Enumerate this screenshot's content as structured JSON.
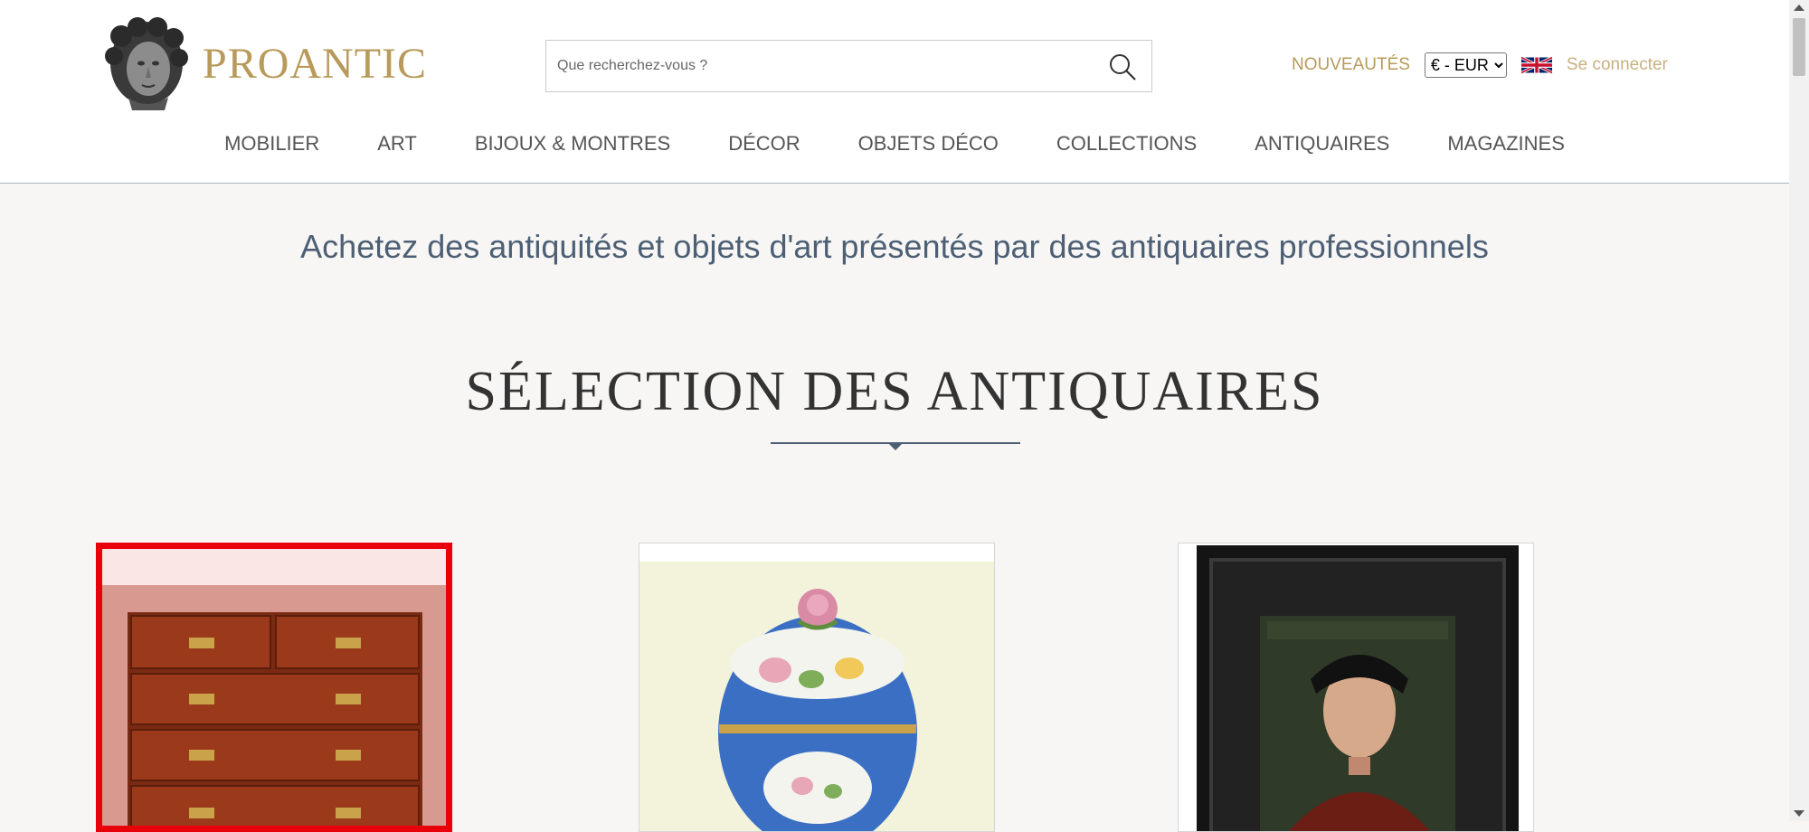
{
  "site": {
    "name": "PROANTIC"
  },
  "search": {
    "placeholder": "Que recherchez-vous ?"
  },
  "header": {
    "news_label": "NOUVEAUTÉS",
    "currency": {
      "selected": "€ - EUR"
    },
    "language_flag": "uk-flag-icon",
    "login_label": "Se connecter"
  },
  "nav": {
    "items": [
      {
        "label": "MOBILIER"
      },
      {
        "label": "ART"
      },
      {
        "label": "BIJOUX & MONTRES"
      },
      {
        "label": "DÉCOR"
      },
      {
        "label": "OBJETS DÉCO"
      },
      {
        "label": "COLLECTIONS"
      },
      {
        "label": "ANTIQUAIRES"
      },
      {
        "label": "MAGAZINES"
      }
    ]
  },
  "main": {
    "tagline": "Achetez des antiquités et objets d'art présentés par des antiquaires professionnels",
    "section_title": "SÉLECTION DES ANTIQUAIRES",
    "cards": [
      {
        "subject": "campaign-chest-of-drawers",
        "selected": true
      },
      {
        "subject": "porcelain-lidded-pot"
      },
      {
        "subject": "framed-portrait-painting"
      }
    ]
  },
  "colors": {
    "brand_gold": "#b89a5a",
    "tagline_blue": "#4d5f75",
    "selection_red": "#e8000b"
  }
}
